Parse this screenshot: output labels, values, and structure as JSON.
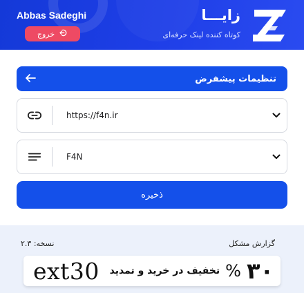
{
  "header": {
    "user_name": "Abbas Sadeghi",
    "logout_label": "خروج",
    "brand_name": "زایـــا",
    "brand_tagline": "کوتاه کننده لینک حرفه‌ای",
    "colors": {
      "header_bg": "#1f3fe8",
      "logout_bg": "#ee4a64"
    }
  },
  "settings": {
    "title": "تنظیمات پیشفرض",
    "domain_select": {
      "value": "https://f4n.ir",
      "icon": "link-icon"
    },
    "type_select": {
      "value": "F4N",
      "icon": "lines-icon"
    },
    "save_label": "ذخیره",
    "colors": {
      "accent": "#1450ea"
    }
  },
  "footer": {
    "report_label": "گزارش مشکل",
    "version_label": "نسخه: ۲.۳",
    "promo": {
      "percent": "۳۰",
      "percent_sign": "%",
      "description": "تخفیف در خرید و تمدید",
      "code": "ext30"
    },
    "colors": {
      "footer_bg": "#ecf1fb"
    }
  }
}
